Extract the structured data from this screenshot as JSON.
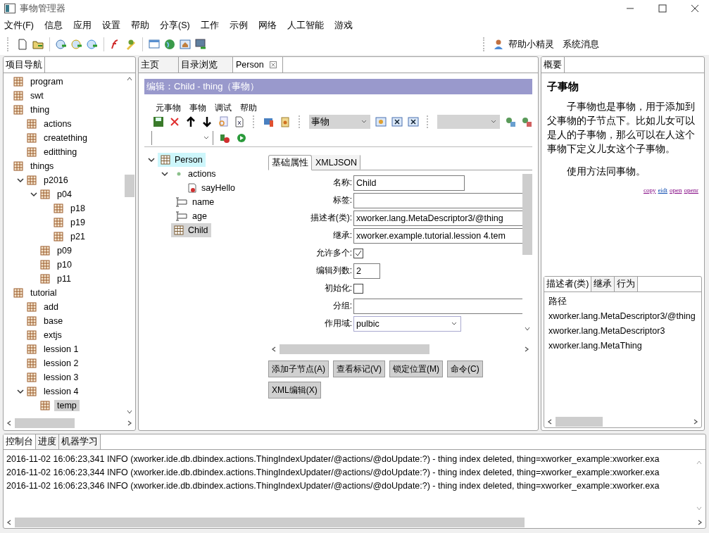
{
  "window": {
    "title": "事物管理器"
  },
  "menu": [
    "文件(F)",
    "信息",
    "应用",
    "设置",
    "帮助",
    "分享(S)",
    "工作",
    "示例",
    "网络",
    "人工智能",
    "游戏"
  ],
  "toolbar_right": {
    "helper": "帮助小精灵",
    "messages": "系统消息"
  },
  "navigator": {
    "tab": "项目导航",
    "tree": [
      {
        "label": "program",
        "selected": false
      },
      {
        "label": "swt",
        "selected": false
      },
      {
        "label": "thing",
        "selected": false,
        "children": [
          {
            "label": "actions",
            "selected": false
          },
          {
            "label": "creatething",
            "selected": false
          },
          {
            "label": "editthing",
            "selected": false
          }
        ]
      },
      {
        "label": "things",
        "selected": false,
        "children": [
          {
            "label": "p2016",
            "selected": false,
            "expanded": true,
            "children": [
              {
                "label": "p04",
                "selected": false,
                "expanded": true,
                "children": [
                  {
                    "label": "p18",
                    "selected": false
                  },
                  {
                    "label": "p19",
                    "selected": false
                  },
                  {
                    "label": "p21",
                    "selected": false
                  }
                ]
              },
              {
                "label": "p09",
                "selected": false
              },
              {
                "label": "p10",
                "selected": false
              },
              {
                "label": "p11",
                "selected": false
              }
            ]
          }
        ]
      },
      {
        "label": "tutorial",
        "selected": false,
        "children": [
          {
            "label": "add",
            "selected": false
          },
          {
            "label": "base",
            "selected": false
          },
          {
            "label": "extjs",
            "selected": false
          },
          {
            "label": "lession 1",
            "selected": false
          },
          {
            "label": "lession 2",
            "selected": false
          },
          {
            "label": "lession 3",
            "selected": false
          },
          {
            "label": "lession 4",
            "selected": false,
            "expanded": true,
            "children": [
              {
                "label": "temp",
                "selected": true
              }
            ]
          }
        ]
      }
    ]
  },
  "editor": {
    "tabs": [
      {
        "label": "主页",
        "selected": false
      },
      {
        "label": "目录浏览",
        "selected": false
      },
      {
        "label": "Person",
        "selected": true,
        "closable": true
      }
    ],
    "header": "编辑：Child - thing（事物）",
    "menu": [
      "元事物",
      "事物",
      "调试",
      "帮助"
    ],
    "type_combo": "事物",
    "tree": [
      {
        "label": "Person",
        "kind": "table",
        "selected": false,
        "hovered": true,
        "expanded": true,
        "children": [
          {
            "label": "actions",
            "kind": "dot",
            "selected": false,
            "hovered": false,
            "expanded": true,
            "children": [
              {
                "label": "sayHello",
                "kind": "script",
                "selected": false,
                "hovered": false
              }
            ]
          },
          {
            "label": "name",
            "kind": "field",
            "selected": false,
            "hovered": false
          },
          {
            "label": "age",
            "kind": "field",
            "selected": false,
            "hovered": false
          },
          {
            "label": "Child",
            "kind": "table",
            "selected": true,
            "hovered": false
          }
        ]
      }
    ],
    "form_tabs": [
      {
        "label": "基础属性",
        "selected": true
      },
      {
        "label": "XMLJSON",
        "selected": false
      }
    ],
    "fields": [
      {
        "label": "名称:",
        "kind": "short",
        "value": "Child"
      },
      {
        "label": "标签:",
        "kind": "text"
      },
      {
        "label": "描述者(类):",
        "kind": "text",
        "value": "xworker.lang.MetaDescriptor3/@thing"
      },
      {
        "label": "继承:",
        "kind": "text",
        "value": "xworker.example.tutorial.lession 4.tem"
      },
      {
        "label": "允许多个:",
        "kind": "checkbox",
        "checked": true
      },
      {
        "label": "编辑列数:",
        "kind": "number",
        "value": "2"
      },
      {
        "label": "初始化:",
        "kind": "checkbox",
        "checked": false
      },
      {
        "label": "分组:",
        "kind": "text"
      },
      {
        "label": "作用域:",
        "kind": "select",
        "value": "pulbic"
      }
    ],
    "buttons": [
      "添加子节点(A)",
      "查看标记(V)",
      "锁定位置(M)",
      "命令(C)",
      "XML编辑(X)"
    ]
  },
  "summary": {
    "tab": "概要",
    "title": "子事物",
    "paragraphs": [
      "子事物也是事物，用于添加到父事物的子节点下。比如儿女可以是人的子事物，那么可以在人这个事物下定义儿女这个子事物。",
      "使用方法同事物。"
    ],
    "links": [
      {
        "label": "copy",
        "visited": true
      },
      {
        "label": "eidt",
        "visited": false
      },
      {
        "label": "open",
        "visited": true
      },
      {
        "label": "openr",
        "visited": true
      }
    ]
  },
  "descriptors": {
    "tabs": [
      {
        "label": "描述者(类)",
        "selected": true
      },
      {
        "label": "继承",
        "selected": false
      },
      {
        "label": "行为",
        "selected": false
      }
    ],
    "header": "路径",
    "rows": [
      "xworker.lang.MetaDescriptor3/@thing",
      "xworker.lang.MetaDescriptor3",
      "xworker.lang.MetaThing"
    ]
  },
  "console": {
    "tabs": [
      {
        "label": "控制台",
        "selected": true
      },
      {
        "label": "进度",
        "selected": false
      },
      {
        "label": "机器学习",
        "selected": false
      }
    ],
    "lines": [
      "2016-11-02 16:06:23,341  INFO (xworker.ide.db.dbindex.actions.ThingIndexUpdater/@actions/@doUpdate:?) - thing index deleted, thing=xworker_example:xworker.exa",
      "2016-11-02 16:06:23,344  INFO (xworker.ide.db.dbindex.actions.ThingIndexUpdater/@actions/@doUpdate:?) - thing index deleted, thing=xworker_example:xworker.exa",
      "2016-11-02 16:06:23,346  INFO (xworker.ide.db.dbindex.actions.ThingIndexUpdater/@actions/@doUpdate:?) - thing index deleted, thing=xworker_example:xworker.exa"
    ]
  }
}
